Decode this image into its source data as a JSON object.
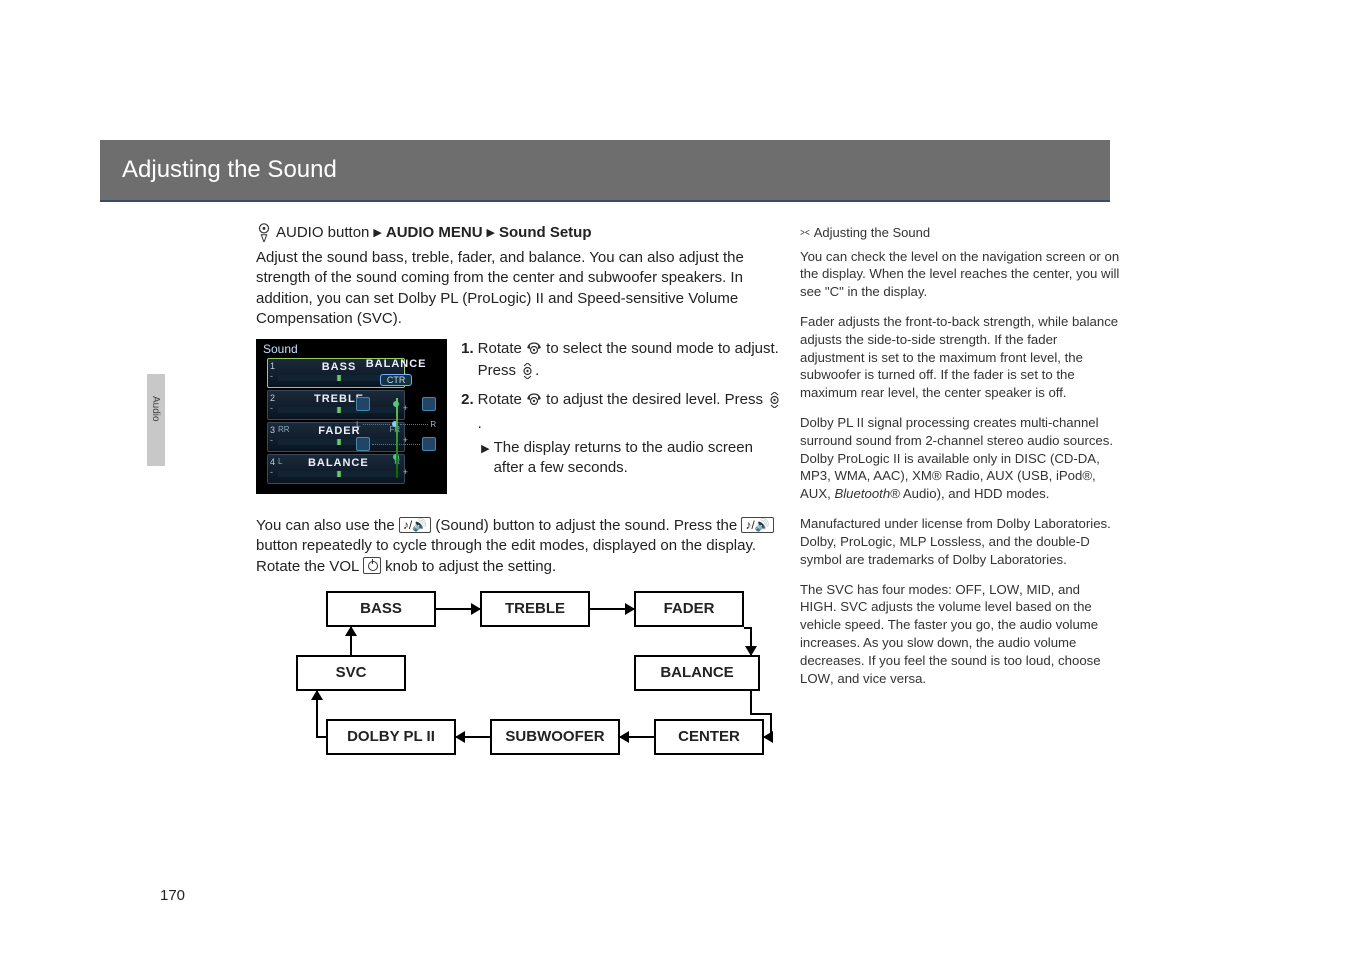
{
  "title": "Adjusting the Sound",
  "sideTabLabel": "Audio",
  "pageNumber": "170",
  "breadcrumb": {
    "btn": "AUDIO button",
    "m1": "AUDIO MENU",
    "m2": "Sound Setup"
  },
  "introText": "Adjust the sound bass, treble, fader, and balance. You can also adjust the strength of the sound coming from the center and subwoofer speakers. In addition, you can set Dolby PL (ProLogic) II and Speed-sensitive Volume Compensation (SVC).",
  "steps": {
    "s1a": "Rotate ",
    "s1b": " to select the sound mode to adjust. Press ",
    "s1c": ".",
    "s2a": "Rotate ",
    "s2b": " to adjust the desired level. Press ",
    "s2c": ".",
    "sub": "The display returns to the audio screen after a few seconds."
  },
  "screenshot": {
    "header": "Sound",
    "items": [
      {
        "idx": "1",
        "label": "BASS",
        "type": "slider"
      },
      {
        "idx": "2",
        "label": "TREBLE",
        "type": "slider"
      },
      {
        "idx": "3",
        "label": "FADER",
        "type": "fr",
        "l": "RR",
        "r": "FR"
      },
      {
        "idx": "4",
        "label": "BALANCE",
        "type": "fr",
        "l": "L",
        "r": "R"
      }
    ],
    "rightTitle": "BALANCE",
    "ctr": "CTR",
    "L": "L",
    "R": "R"
  },
  "underText": {
    "a": "You can also use the ",
    "b": " (Sound) button to adjust the sound. Press the ",
    "c": " button repeatedly to cycle through the edit modes, displayed on the display. Rotate the VOL ",
    "d": " knob to adjust the setting."
  },
  "flow": {
    "bass": "BASS",
    "treble": "TREBLE",
    "fader": "FADER",
    "svc": "SVC",
    "balance": "BALANCE",
    "dolby": "DOLBY PL II",
    "sub": "SUBWOOFER",
    "center": "CENTER"
  },
  "sidebar": {
    "heading": "Adjusting the Sound",
    "p1": "You can check the level on the navigation screen or on the display. When the level reaches the center, you will see \"C\" in the display.",
    "p2": "Fader adjusts the front-to-back strength, while balance adjusts the side-to-side strength. If the fader adjustment is set to the maximum front level, the subwoofer is turned off. If the fader is set to the maximum rear level, the center speaker is off.",
    "p3a": "Dolby PL II signal processing creates multi-channel surround sound from 2-channel stereo audio sources. Dolby ProLogic II is available only in DISC (CD-DA, MP3, WMA, AAC), XM® Radio, AUX (USB, iPod®, AUX, ",
    "p3i": "Bluetooth",
    "p3b": "® Audio), and HDD modes.",
    "p4": "Manufactured under license from Dolby Laboratories. Dolby, ProLogic, MLP Lossless, and the double-D symbol are trademarks of Dolby Laboratories.",
    "p5a": "The ",
    "p5svc": "SVC",
    "p5b": " has four modes: ",
    "p5off": "OFF",
    "p5c": ", ",
    "p5low": "LOW",
    "p5d": ", ",
    "p5mid": "MID",
    "p5e": ", and ",
    "p5high": "HIGH",
    "p5f": ". SVC adjusts the volume level based on the vehicle speed. The faster you go, the audio volume increases. As you slow down, the audio volume decreases. If you feel the sound is too loud, choose ",
    "p5low2": "LOW",
    "p5g": ", and vice versa."
  }
}
